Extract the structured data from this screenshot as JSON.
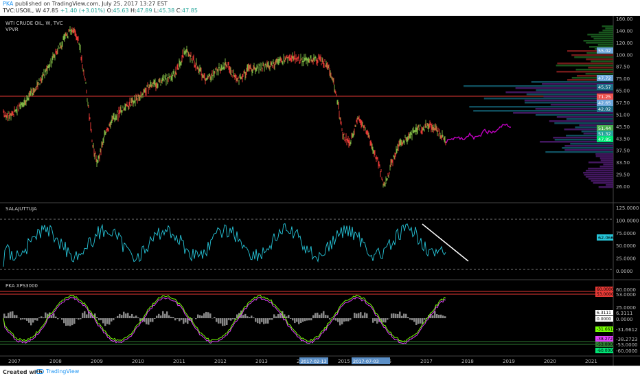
{
  "header": {
    "user": "PKA",
    "published": "published on TradingView.com, July 25, 2017 13:27 EST",
    "symbol": "TVC:USOIL, W",
    "last": "47.85",
    "change": "+1.40 (+3.01%)",
    "open_label": "O:",
    "open": "45.63",
    "high_label": "H:",
    "high": "47.89",
    "low_label": "L:",
    "low": "45.38",
    "close_label": "C:",
    "close": "47.85"
  },
  "panes": {
    "main": {
      "title": "WTI CRUDE OIL, W, TVC",
      "indicator": "VPVR"
    },
    "osc1": {
      "title": "SALAJUTTUJA"
    },
    "osc2": {
      "title": "PKA XPS3000"
    }
  },
  "price_axis": [
    "160.00",
    "140.00",
    "120.00",
    "100.00",
    "87.50",
    "75.00",
    "65.00",
    "57.50",
    "51.00",
    "45.50",
    "43.50",
    "37.50",
    "33.50",
    "29.50",
    "26.00"
  ],
  "price_tags": [
    {
      "label": "55.02",
      "color": "#6fa8dc"
    },
    {
      "label": "47.72",
      "color": "#6fa8dc"
    },
    {
      "label": "45.57",
      "color": "#1f6f8b"
    },
    {
      "label": "71.25",
      "color": "#ef5350"
    },
    {
      "label": "42.65",
      "color": "#6fa8dc"
    },
    {
      "label": "42.02",
      "color": "#1f6f8b"
    },
    {
      "label": "51.44",
      "color": "#4caf50"
    },
    {
      "label": "51.32",
      "color": "#26a69a"
    },
    {
      "label": "47.85",
      "color": "#00e676"
    }
  ],
  "osc1_axis": [
    "125.0000",
    "100.0000",
    "75.0000",
    "50.0000",
    "25.0000",
    "0.0000"
  ],
  "osc1_tag": {
    "label": "62.0663",
    "color": "#26c6da"
  },
  "osc2_axis": [
    "60.0000",
    "53.0000",
    "25.0000",
    "6.3111",
    "0.0000",
    "-31.6612",
    "-38.2723",
    "-53.0000",
    "-60.0000"
  ],
  "time_axis": [
    "2007",
    "2008",
    "2009",
    "2010",
    "2011",
    "2012",
    "2013",
    "2014",
    "2015",
    "2016",
    "2017",
    "2018",
    "2019",
    "2020",
    "2021"
  ],
  "time_tags": [
    "2017-02-13",
    "2017-07-03"
  ],
  "footer": {
    "created": "Created with",
    "brand": "TradingView"
  },
  "colors": {
    "up": "#7cb342",
    "down": "#e53935",
    "projection": "#c000c0",
    "osc1": "#26c6da",
    "hline_red": "#e53935",
    "hline_green": "#2e7d32",
    "vp_red": "#7f1d1d",
    "vp_green": "#1b5e20",
    "vp_teal": "#115566",
    "vp_purple": "#4a1a6a"
  }
}
